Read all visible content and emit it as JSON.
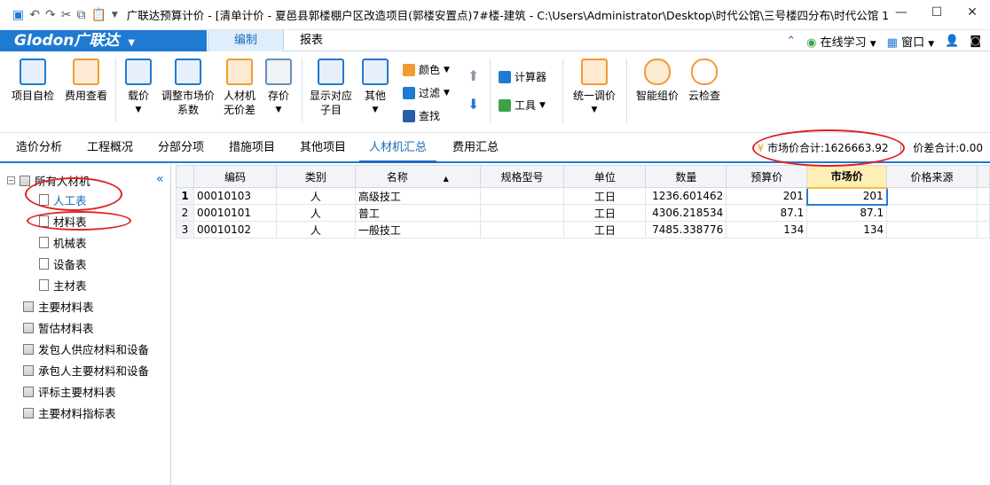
{
  "window": {
    "title": "广联达预算计价 - [清单计价 - 夏邑县郭楼棚户区改造项目(郭楼安置点)7#楼-建筑 - C:\\Users\\Administrator\\Desktop\\时代公馆\\三号楼四分布\\时代公馆 1...",
    "minimize": "—",
    "maximize": "☐",
    "close": "✕"
  },
  "menubar": {
    "brand": "Glodon广联达",
    "tabs": [
      "编制",
      "报表"
    ],
    "online_learning": "在线学习",
    "window": "窗口"
  },
  "ribbon": {
    "buttons": [
      "项目自检",
      "费用查看",
      "载价",
      "调整市场价系数",
      "人材机无价差",
      "存价",
      "显示对应子目",
      "其他",
      "统一调价",
      "智能组价",
      "云检查"
    ],
    "small": {
      "color": "颜色",
      "filter": "过滤",
      "find": "查找",
      "calculator": "计算器",
      "tools": "工具"
    },
    "colors": {
      "accent": "#1f7ad1",
      "orange": "#f29b32",
      "green": "#3aa348"
    }
  },
  "tabs2": {
    "items": [
      "造价分析",
      "工程概况",
      "分部分项",
      "措施项目",
      "其他项目",
      "人材机汇总",
      "费用汇总"
    ],
    "active": "人材机汇总",
    "market_total": "市场价合计:1626663.92",
    "diff_total": "价差合计:0.00"
  },
  "tree": {
    "root": "所有人材机",
    "children": [
      "人工表",
      "材料表",
      "机械表",
      "设备表",
      "主材表"
    ],
    "others": [
      "主要材料表",
      "暂估材料表",
      "发包人供应材料和设备",
      "承包人主要材料和设备",
      "评标主要材料表",
      "主要材料指标表"
    ]
  },
  "table": {
    "headers": [
      "编码",
      "类别",
      "名称",
      "规格型号",
      "单位",
      "数量",
      "预算价",
      "市场价",
      "价格来源"
    ],
    "rows": [
      {
        "no": "1",
        "code": "00010103",
        "type": "人",
        "name": "高级技工",
        "spec": "",
        "unit": "工日",
        "qty": "1236.601462",
        "budget": "201",
        "market": "201",
        "source": ""
      },
      {
        "no": "2",
        "code": "00010101",
        "type": "人",
        "name": "普工",
        "spec": "",
        "unit": "工日",
        "qty": "4306.218534",
        "budget": "87.1",
        "market": "87.1",
        "source": ""
      },
      {
        "no": "3",
        "code": "00010102",
        "type": "人",
        "name": "一般技工",
        "spec": "",
        "unit": "工日",
        "qty": "7485.338776",
        "budget": "134",
        "market": "134",
        "source": ""
      }
    ]
  }
}
